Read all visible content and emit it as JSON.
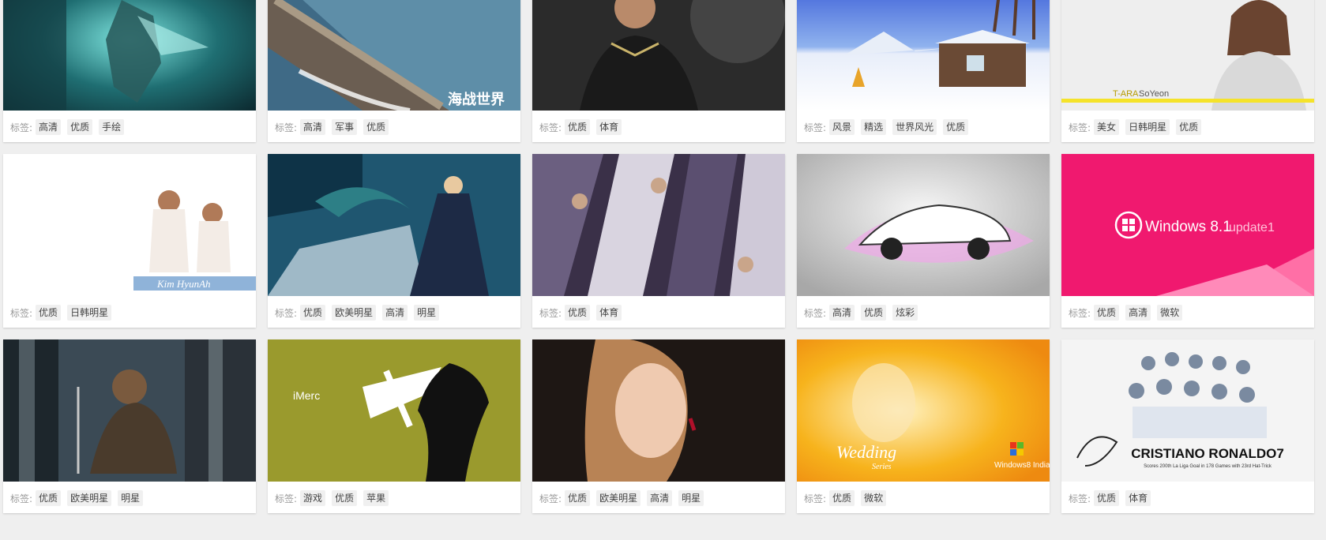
{
  "tag_prefix": "标签:",
  "thumb_texts": {
    "warship": "海战世界",
    "tara_brand": "T-ARA",
    "tara_name": "SoYeon",
    "kim": "Kim HyunAh",
    "win_title": "Windows 8.1",
    "win_update": "update1",
    "imerc": "iMerc",
    "wedding": "Wedding",
    "wedding_sub": "Series",
    "win8india": "Windows8 India",
    "ronaldo_name": "CRISTIANO RONALDO7",
    "ronaldo_sub": "Scores 200th La Liga Goal in 178 Games with 23rd Hat-Trick"
  },
  "cards": [
    {
      "tags": [
        "高清",
        "优质",
        "手绘"
      ]
    },
    {
      "tags": [
        "高清",
        "军事",
        "优质"
      ]
    },
    {
      "tags": [
        "优质",
        "体育"
      ]
    },
    {
      "tags": [
        "风景",
        "精选",
        "世界风光",
        "优质"
      ]
    },
    {
      "tags": [
        "美女",
        "日韩明星",
        "优质"
      ]
    },
    {
      "tags": [
        "优质",
        "日韩明星"
      ]
    },
    {
      "tags": [
        "优质",
        "欧美明星",
        "高清",
        "明星"
      ]
    },
    {
      "tags": [
        "优质",
        "体育"
      ]
    },
    {
      "tags": [
        "高清",
        "优质",
        "炫彩"
      ]
    },
    {
      "tags": [
        "优质",
        "高清",
        "微软"
      ]
    },
    {
      "tags": [
        "优质",
        "欧美明星",
        "明星"
      ]
    },
    {
      "tags": [
        "游戏",
        "优质",
        "苹果"
      ]
    },
    {
      "tags": [
        "优质",
        "欧美明星",
        "高清",
        "明星"
      ]
    },
    {
      "tags": [
        "优质",
        "微软"
      ]
    },
    {
      "tags": [
        "优质",
        "体育"
      ]
    }
  ]
}
